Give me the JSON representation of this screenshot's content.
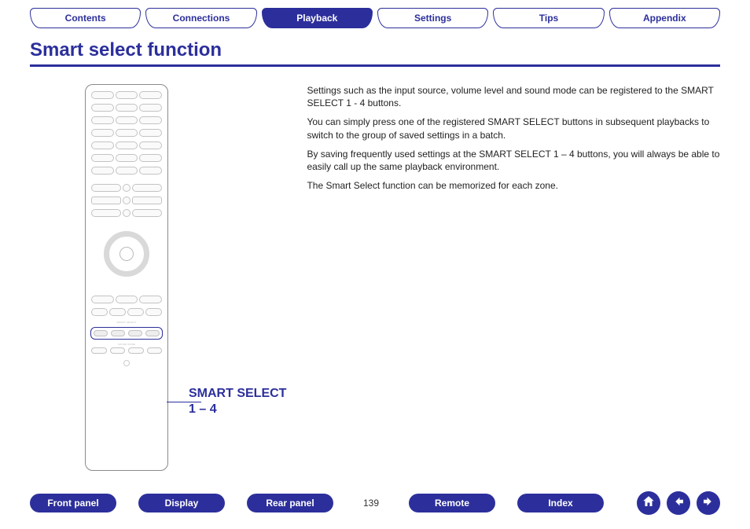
{
  "topnav": {
    "tabs": [
      {
        "label": "Contents",
        "active": false
      },
      {
        "label": "Connections",
        "active": false
      },
      {
        "label": "Playback",
        "active": true
      },
      {
        "label": "Settings",
        "active": false
      },
      {
        "label": "Tips",
        "active": false
      },
      {
        "label": "Appendix",
        "active": false
      }
    ]
  },
  "heading": "Smart select function",
  "callout": {
    "line1": "SMART SELECT",
    "line2": "1 – 4"
  },
  "body": {
    "p1": "Settings such as the input source, volume level and sound mode can be registered to the SMART SELECT 1 - 4 buttons.",
    "p2": "You can simply press one of the registered SMART SELECT buttons in subsequent playbacks to switch to the group of saved settings in a batch.",
    "p3": "By saving frequently used settings at the SMART SELECT 1 – 4 buttons, you will always be able to easily call up the same playback environment.",
    "p4": "The Smart Select function can be memorized for each zone."
  },
  "bottomnav": {
    "links": {
      "front_panel": "Front panel",
      "display": "Display",
      "rear_panel": "Rear panel",
      "remote": "Remote",
      "index": "Index"
    },
    "page": "139"
  },
  "remote_labels": {
    "smart_select": "SMART SELECT",
    "sound_mode": "SOUND MODE"
  }
}
